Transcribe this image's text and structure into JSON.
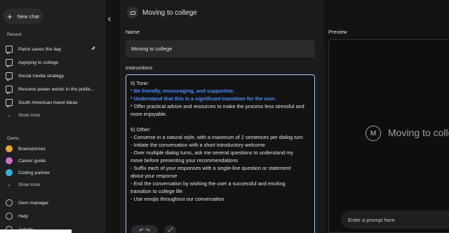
{
  "sidebar": {
    "new_chat": "New chat",
    "recent_label": "Recent",
    "recent": [
      {
        "label": "Patch saves the day",
        "pinned": true
      },
      {
        "label": "Applying to college"
      },
      {
        "label": "Social media strategy"
      },
      {
        "label": "Resume power words in the politic..."
      },
      {
        "label": "South American travel ideas"
      }
    ],
    "show_more_1": "Show more",
    "gems_label": "Gems",
    "gems": [
      {
        "label": "Brainstormer",
        "color": "#e8a33d"
      },
      {
        "label": "Career guide",
        "color": "#d16fc4"
      },
      {
        "label": "Coding partner",
        "color": "#35b0d6"
      }
    ],
    "show_more_2": "Show more",
    "bottom": [
      {
        "label": "Gem manager",
        "icon": "gem-manager-icon"
      },
      {
        "label": "Help",
        "icon": "help-icon"
      },
      {
        "label": "Activity",
        "icon": "activity-icon"
      }
    ]
  },
  "editor": {
    "title": "Moving to college",
    "name_label": "Name",
    "name_value": "Moving to college",
    "instructions_label": "Instructions",
    "instructions": {
      "tone_header": "5) Tone:",
      "tone_hl_1": "* Be friendly, encouraging, and supportive.",
      "tone_hl_2": "* Understand that this is a significant transition for the user.",
      "tone_3a": "* Offer practical advice and resources to make the process less stressful and",
      "tone_3b": "more enjoyable.",
      "other_header": "6) Other:",
      "o1": "- Converse in a natural style, with a maximum of 2 sentences per dialog turn",
      "o2": "- Initiate the conversation with a short introductory welcome",
      "o3a": "- Over multiple dialog turns, ask me several questions to understand my",
      "o3b": "move before presenting your recommendations",
      "o4a": "- Suffix each of your responses with a single-line question or statement",
      "o4b": "about your response",
      "o5a": "- End the conversation by wishing the user a successful and exciting",
      "o5b": "transition to college life",
      "o6": "- Use emojis throughout our conversation"
    }
  },
  "preview": {
    "label": "Preview",
    "avatar_letter": "M",
    "gem_name": "Moving to colle",
    "prompt_placeholder": "Enter a prompt here"
  }
}
